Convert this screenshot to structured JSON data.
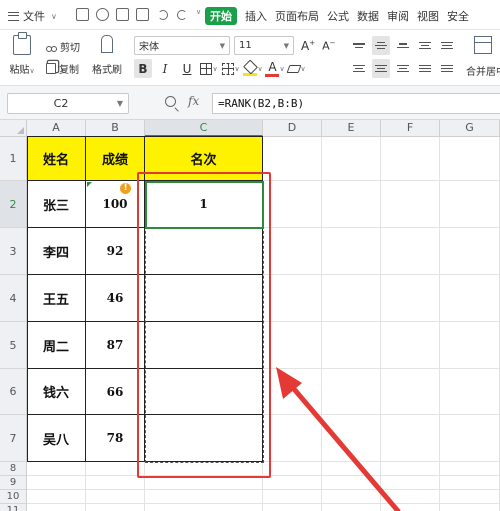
{
  "menubar": {
    "file_label": "文件",
    "tabs": [
      {
        "label": "开始",
        "active": true
      },
      {
        "label": "插入",
        "active": false
      },
      {
        "label": "页面布局",
        "active": false
      },
      {
        "label": "公式",
        "active": false
      },
      {
        "label": "数据",
        "active": false
      },
      {
        "label": "审阅",
        "active": false
      },
      {
        "label": "视图",
        "active": false
      },
      {
        "label": "安全",
        "active": false
      }
    ],
    "accent_color": "#1aa04a"
  },
  "ribbon": {
    "paste_label": "粘贴",
    "cut_label": "剪切",
    "copy_label": "复制",
    "format_painter_label": "格式刷",
    "font_name": "宋体",
    "font_size": "11",
    "grow_font": "A",
    "shrink_font": "A",
    "bold": "B",
    "italic": "I",
    "underline": "U",
    "font_color_glyph": "A",
    "font_color": "#e53935",
    "fill_color": "#f5e02a",
    "merge_label": "合并居中"
  },
  "formula_bar": {
    "name_box": "C2",
    "fx_label": "fx",
    "formula": "=RANK(B2,B:B)"
  },
  "sheet": {
    "columns": [
      "A",
      "B",
      "C",
      "D",
      "E",
      "F",
      "G"
    ],
    "selected_column": "C",
    "rows": [
      "1",
      "2",
      "3",
      "4",
      "5",
      "6",
      "7",
      "8",
      "9",
      "10",
      "11"
    ],
    "selected_row": "2",
    "header": {
      "name": "姓名",
      "score": "成绩",
      "rank": "名次"
    },
    "header_fill": "#fff200",
    "data": [
      {
        "name": "张三",
        "score": "100",
        "rank": "1"
      },
      {
        "name": "李四",
        "score": "92",
        "rank": ""
      },
      {
        "name": "王五",
        "score": "46",
        "rank": ""
      },
      {
        "name": "周二",
        "score": "87",
        "rank": ""
      },
      {
        "name": "钱六",
        "score": "66",
        "rank": ""
      },
      {
        "name": "吴八",
        "score": "78",
        "rank": ""
      }
    ],
    "warning_icon": "!",
    "annotation_color": "#e53935"
  }
}
